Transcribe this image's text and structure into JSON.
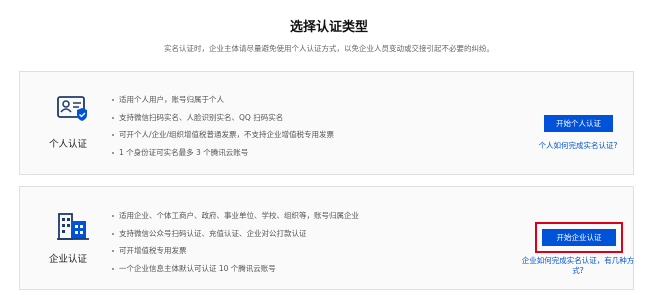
{
  "header": {
    "title": "选择认证类型",
    "description": "实名认证时，企业主体请尽量避免使用个人认证方式，以免企业人员变动或交接引起不必要的纠纷。"
  },
  "personal": {
    "name": "个人认证",
    "icon": "id-card-icon",
    "features": [
      "适用个人用户，账号归属于个人",
      "支持微信扫码实名、人脸识别实名、QQ 扫码实名",
      "可开个人/企业/组织增值税普通发票，不支持企业增值税专用发票",
      "1 个身份证可实名最多 3 个腾讯云账号"
    ],
    "button_label": "开始个人认证",
    "help_link": "个人如何完成实名认证?"
  },
  "enterprise": {
    "name": "企业认证",
    "icon": "building-icon",
    "features": [
      "适用企业、个体工商户、政府、事业单位、学校、组织等，账号归属企业",
      "支持微信公众号扫码认证、充值认证、企业对公打款认证",
      "可开增值税专用发票",
      "一个企业信息主体默认可认证 10 个腾讯云账号"
    ],
    "button_label": "开始企业认证",
    "help_link": "企业如何完成实名认证，有几种方式?"
  },
  "colors": {
    "accent": "#0052d9",
    "highlight": "#d9001b",
    "card_border": "#dcdfe6",
    "card_bg": "#fafafa"
  }
}
